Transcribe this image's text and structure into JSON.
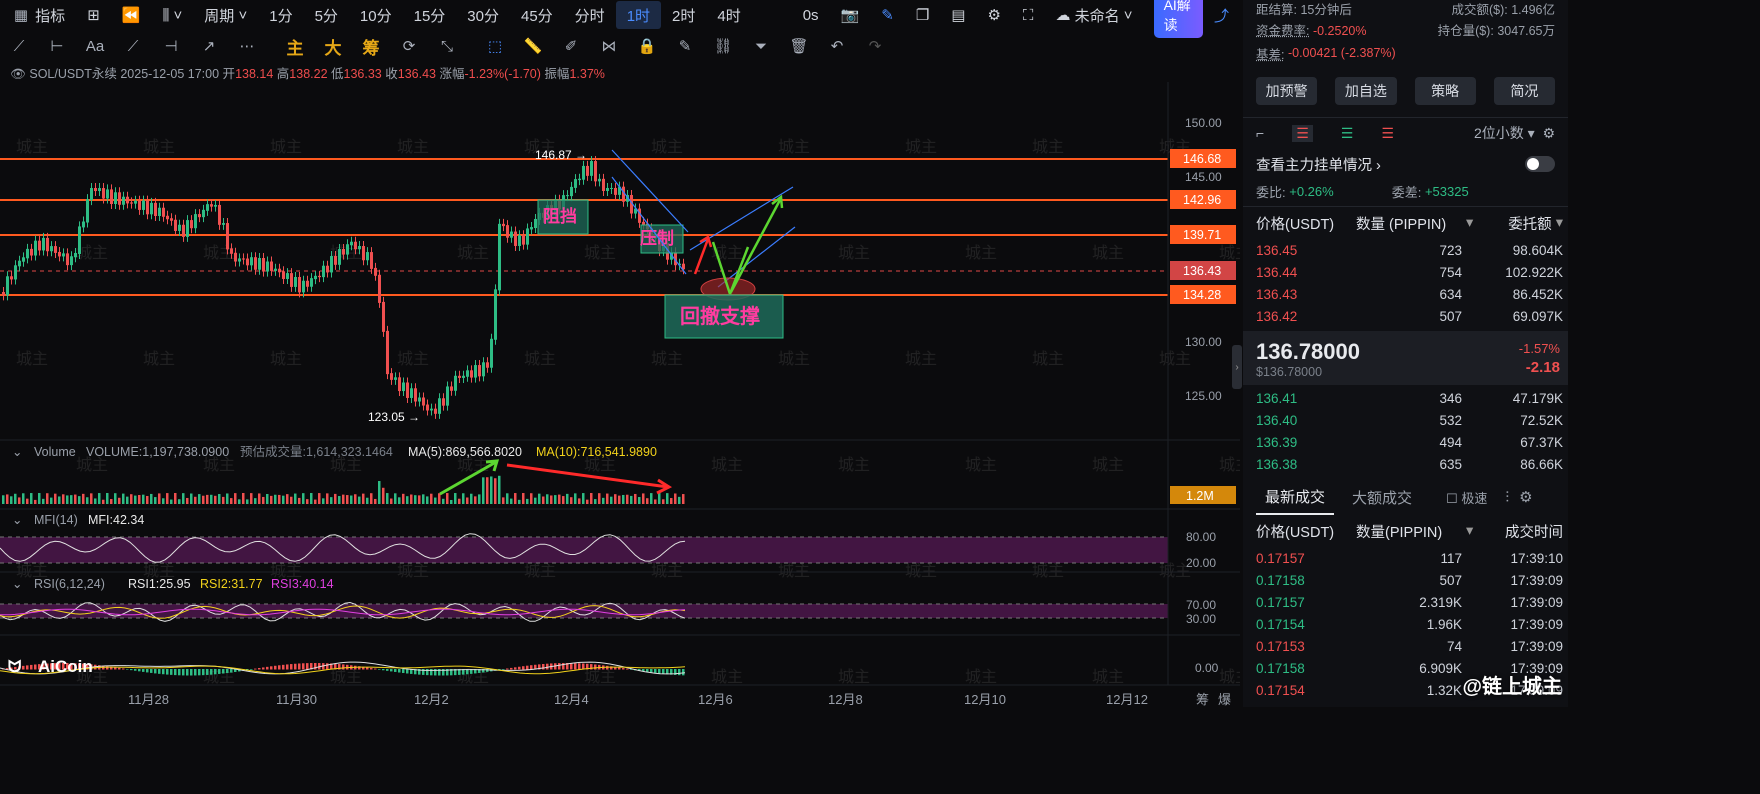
{
  "toolbar": {
    "indicator_label": "指标",
    "period_label": "周期",
    "intervals": [
      "1分",
      "5分",
      "10分",
      "15分",
      "30分",
      "45分",
      "分时",
      "1时",
      "2时",
      "4时"
    ],
    "active_interval": "1时",
    "os_label": "0s",
    "layout_name": "未命名",
    "ai_button": "AI解读"
  },
  "drawing_tools": {
    "main": "主",
    "big": "大",
    "chips": "筹"
  },
  "ohlc": {
    "symbol": "SOL/USDT永续",
    "datetime": "2025-12-05 17:00",
    "open_label": "开",
    "open": "138.14",
    "high_label": "高",
    "high": "138.22",
    "low_label": "低",
    "low": "136.33",
    "close_label": "收",
    "close": "136.43",
    "change_label": "涨幅",
    "change": "-1.23%(-1.70)",
    "amp_label": "振幅",
    "amp": "1.37%"
  },
  "price_axis": [
    "150.00",
    "145.00",
    "130.00",
    "125.00"
  ],
  "hlines": [
    {
      "price": "146.68",
      "color": "#ff5a1f"
    },
    {
      "price": "142.96",
      "color": "#ff5a1f"
    },
    {
      "price": "139.71",
      "color": "#ff5a1f"
    },
    {
      "price": "136.43",
      "color": "#e04848"
    },
    {
      "price": "134.28",
      "color": "#ff5a1f"
    }
  ],
  "annotations": {
    "high": "146.87 →",
    "low": "123.05 →",
    "box1": "阻挡",
    "box2": "压制",
    "support": "回撤支撑"
  },
  "volume": {
    "label": "Volume",
    "value": "VOLUME:1,197,738.0900",
    "est": "预估成交量:1,614,323.1464",
    "ma5": "MA(5):869,566.8020",
    "ma10": "MA(10):716,541.9890",
    "axis": "1.2M"
  },
  "mfi": {
    "label": "MFI(14)",
    "value": "MFI:42.34",
    "ticks": [
      "80.00",
      "20.00"
    ]
  },
  "rsi": {
    "label": "RSI(6,12,24)",
    "r1": "RSI1:25.95",
    "r2": "RSI2:31.77",
    "r3": "RSI3:40.14",
    "ticks": [
      "70.00",
      "30.00"
    ]
  },
  "macd": {
    "tick": "0.00"
  },
  "xaxis": [
    "11月28",
    "11月30",
    "12月2",
    "12月4",
    "12月6",
    "12月8",
    "12月10",
    "12月12"
  ],
  "xaxis_right": [
    "筹",
    "爆"
  ],
  "logo": "AiCoin",
  "watermark": "城主",
  "corner_credit": "@链上城主",
  "right": {
    "settle_label": "距结算:",
    "settle_value": "15分钟后",
    "turnover_label": "成交额($):",
    "turnover_value": "1.496亿",
    "funding_label": "资金费率:",
    "funding_value": "-0.2520%",
    "oi_label": "持仓量($):",
    "oi_value": "3047.65万",
    "basis_label": "基差:",
    "basis_value": "-0.00421 (-2.387%)",
    "buttons": [
      "加预警",
      "加自选",
      "策略",
      "简况"
    ],
    "decimals": "2位小数",
    "view_label": "查看主力挂单情况",
    "ratio_label": "委比:",
    "ratio_value": "+0.26%",
    "diff_label": "委差:",
    "diff_value": "+53325",
    "ob_headers": [
      "价格(USDT)",
      "数量 (PIPPIN)",
      "委托额"
    ],
    "asks": [
      [
        "136.45",
        "723",
        "98.604K"
      ],
      [
        "136.44",
        "754",
        "102.922K"
      ],
      [
        "136.43",
        "634",
        "86.452K"
      ],
      [
        "136.42",
        "507",
        "69.097K"
      ]
    ],
    "last_price": "136.78000",
    "last_usd": "$136.78000",
    "last_pct": "-1.57%",
    "last_chg": "-2.18",
    "bids": [
      [
        "136.41",
        "346",
        "47.179K"
      ],
      [
        "136.40",
        "532",
        "72.52K"
      ],
      [
        "136.39",
        "494",
        "67.37K"
      ],
      [
        "136.38",
        "635",
        "86.66K"
      ]
    ],
    "trade_tabs": [
      "最新成交",
      "大额成交"
    ],
    "fast_label": "极速",
    "trade_headers": [
      "价格(USDT)",
      "数量(PIPPIN)",
      "成交时间"
    ],
    "trades": [
      [
        "0.17157",
        "117",
        "17:39:10",
        "red"
      ],
      [
        "0.17158",
        "507",
        "17:39:09",
        "grn"
      ],
      [
        "0.17157",
        "2.319K",
        "17:39:09",
        "grn"
      ],
      [
        "0.17154",
        "1.96K",
        "17:39:09",
        "grn"
      ],
      [
        "0.17153",
        "74",
        "17:39:09",
        "red"
      ],
      [
        "0.17158",
        "6.909K",
        "17:39:09",
        "grn"
      ],
      [
        "0.17154",
        "1.32K",
        "17:39:09",
        "red"
      ]
    ]
  }
}
